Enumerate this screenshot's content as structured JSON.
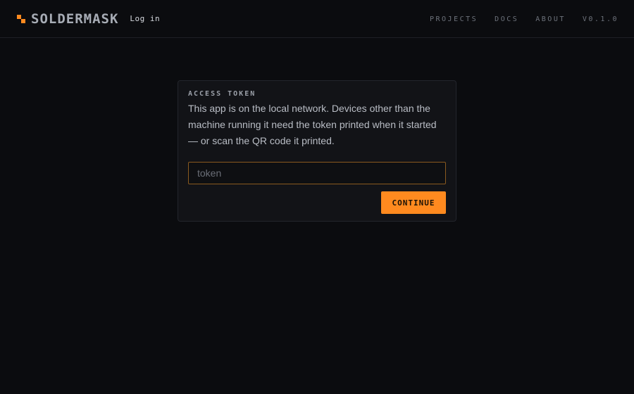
{
  "header": {
    "brand": "SOLDERMASK",
    "login_label": "Log in",
    "nav": {
      "projects": "PROJECTS",
      "docs": "DOCS",
      "about": "ABOUT",
      "version": "V0.1.0"
    }
  },
  "card": {
    "title": "ACCESS TOKEN",
    "description": "This app is on the local network. Devices other than the machine running it need the token printed when it started — or scan the QR code it printed.",
    "input": {
      "placeholder": "token",
      "value": ""
    },
    "continue_label": "CONTINUE"
  },
  "colors": {
    "accent": "#ff8a1f",
    "background": "#0b0c0f",
    "card": "#121317"
  },
  "icons": {
    "logo": "pixel-logo-icon"
  }
}
